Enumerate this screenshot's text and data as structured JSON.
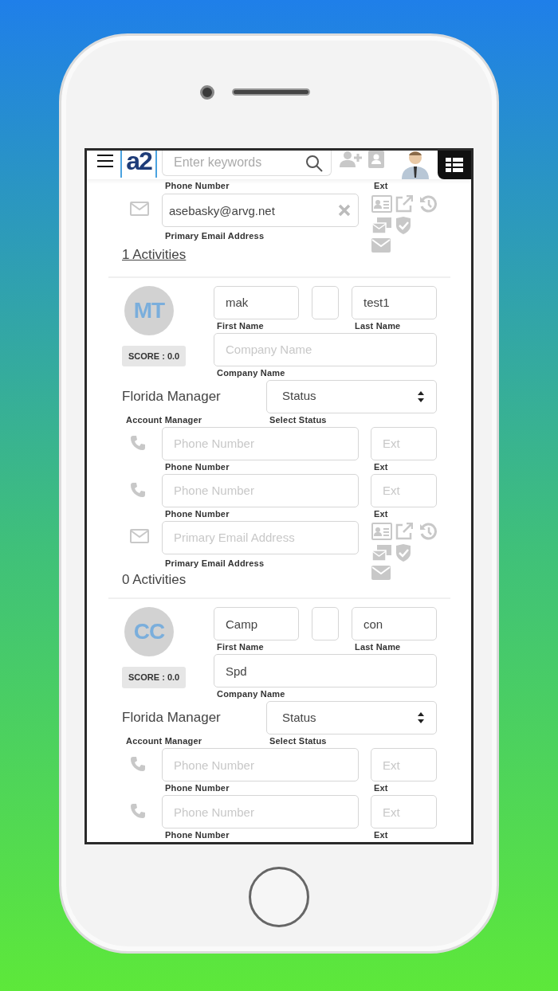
{
  "header": {
    "logo": "a2",
    "search": {
      "placeholder": "Enter keywords"
    }
  },
  "previous_contact": {
    "phone_label": "Phone Number",
    "ext_label": "Ext",
    "email": {
      "value": "asebasky@arvg.net",
      "label": "Primary Email Address"
    },
    "activities": "1 Activities",
    "activities_linked": true
  },
  "contacts": [
    {
      "initials": "MT",
      "score": "SCORE : 0.0",
      "first_name": {
        "value": "mak",
        "label": "First Name"
      },
      "last_name": {
        "value": "test1",
        "label": "Last Name"
      },
      "company": {
        "placeholder": "Company Name",
        "label": "Company Name"
      },
      "manager": "Florida Manager",
      "manager_label": "Account Manager",
      "status": {
        "value": "Status",
        "label": "Select Status"
      },
      "phones": [
        {
          "placeholder": "Phone Number",
          "label": "Phone Number",
          "ext_placeholder": "Ext",
          "ext_label": "Ext"
        },
        {
          "placeholder": "Phone Number",
          "label": "Phone Number",
          "ext_placeholder": "Ext",
          "ext_label": "Ext"
        }
      ],
      "email": {
        "placeholder": "Primary Email Address",
        "label": "Primary Email Address"
      },
      "activities": "0 Activities",
      "activities_linked": false
    },
    {
      "initials": "CC",
      "score": "SCORE : 0.0",
      "first_name": {
        "value": "Camp",
        "label": "First Name"
      },
      "last_name": {
        "value": "con",
        "label": "Last Name"
      },
      "company": {
        "value": "Spd",
        "label": "Company Name"
      },
      "manager": "Florida Manager",
      "manager_label": "Account Manager",
      "status": {
        "value": "Status",
        "label": "Select Status"
      },
      "phones": [
        {
          "placeholder": "Phone Number",
          "label": "Phone Number",
          "ext_placeholder": "Ext",
          "ext_label": "Ext"
        },
        {
          "placeholder": "Phone Number",
          "label": "Phone Number",
          "ext_placeholder": "Ext",
          "ext_label": "Ext"
        }
      ]
    }
  ]
}
